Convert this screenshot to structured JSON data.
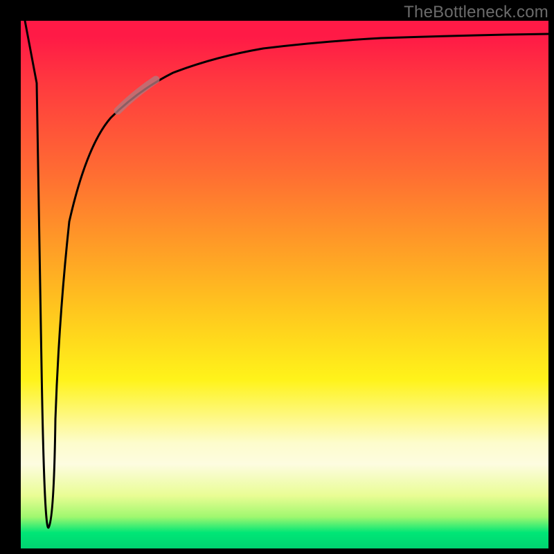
{
  "attribution": "TheBottleneck.com",
  "colors": {
    "frame": "#000000",
    "gradient_top": "#ff1a46",
    "gradient_mid_upper": "#ff9a27",
    "gradient_mid": "#fff31a",
    "gradient_pale_band": "#fdfce0",
    "gradient_bottom": "#00d471",
    "curve": "#000000",
    "highlight": "rgba(180,120,125,0.78)",
    "attribution_text": "#6b6b6b"
  },
  "chart_data": {
    "type": "line",
    "title": "",
    "xlabel": "",
    "ylabel": "",
    "xlim": [
      0,
      100
    ],
    "ylim": [
      0,
      100
    ],
    "series": [
      {
        "name": "bottleneck-curve",
        "x": [
          0,
          3,
          4,
          5,
          6,
          7,
          9,
          12,
          16,
          21,
          28,
          36,
          46,
          58,
          72,
          86,
          100
        ],
        "y": [
          100,
          88,
          35,
          4,
          25,
          45,
          62,
          73,
          80,
          85,
          89,
          91.5,
          93.5,
          95,
          96,
          96.7,
          97.2
        ]
      }
    ],
    "highlight_segment": {
      "series": "bottleneck-curve",
      "x_from": 18,
      "x_to": 25,
      "note": "thicker muted-pink overlay on curve"
    },
    "background_gradient_stops": [
      {
        "pos": 0.0,
        "color": "#ff1a46"
      },
      {
        "pos": 0.28,
        "color": "#ff6a33"
      },
      {
        "pos": 0.55,
        "color": "#ffc71e"
      },
      {
        "pos": 0.68,
        "color": "#fff31a"
      },
      {
        "pos": 0.84,
        "color": "#fdfce0"
      },
      {
        "pos": 0.97,
        "color": "#00e676"
      },
      {
        "pos": 1.0,
        "color": "#00d471"
      }
    ]
  }
}
